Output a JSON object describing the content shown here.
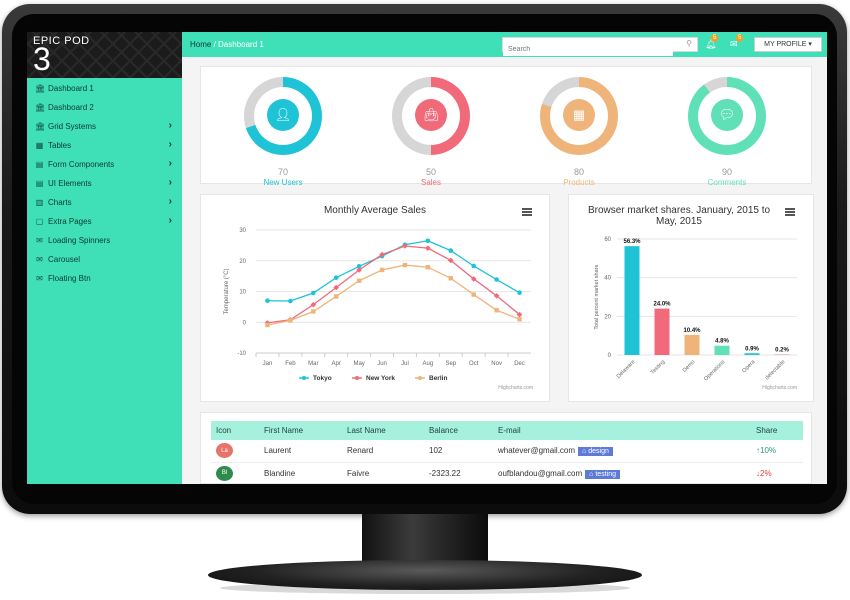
{
  "brand": {
    "name": "EPIC POD",
    "number": "3"
  },
  "sidebar": {
    "items": [
      {
        "label": "Dashboard 1",
        "icon": "bank-icon",
        "has_submenu": false
      },
      {
        "label": "Dashboard 2",
        "icon": "bank-icon",
        "has_submenu": false
      },
      {
        "label": "Grid Systems",
        "icon": "bank-icon",
        "has_submenu": true
      },
      {
        "label": "Tables",
        "icon": "table-icon",
        "has_submenu": true
      },
      {
        "label": "Form Components",
        "icon": "form-icon",
        "has_submenu": true
      },
      {
        "label": "UI Elements",
        "icon": "form-icon",
        "has_submenu": true
      },
      {
        "label": "Charts",
        "icon": "chart-icon",
        "has_submenu": true
      },
      {
        "label": "Extra Pages",
        "icon": "file-icon",
        "has_submenu": true
      },
      {
        "label": "Loading Spinners",
        "icon": "envelope-icon",
        "has_submenu": false
      },
      {
        "label": "Carousel",
        "icon": "envelope-icon",
        "has_submenu": false
      },
      {
        "label": "Floating Btn",
        "icon": "envelope-icon",
        "has_submenu": false
      }
    ]
  },
  "topbar": {
    "breadcrumb_home": "Home",
    "breadcrumb_sep": " / ",
    "breadcrumb_current": "Dashboard 1",
    "search_placeholder": "Search",
    "alerts_count": "5",
    "messages_count": "5",
    "profile_label": "MY PROFILE ▾"
  },
  "stats": [
    {
      "value": "70",
      "label": "New Users",
      "color": "#1ec3d6",
      "percent": 70
    },
    {
      "value": "50",
      "label": "Sales",
      "color": "#f06a7a",
      "percent": 50
    },
    {
      "value": "80",
      "label": "Products",
      "color": "#efb47a",
      "percent": 80
    },
    {
      "value": "90",
      "label": "Comments",
      "color": "#5fe0b6",
      "percent": 90
    }
  ],
  "chart_data": [
    {
      "type": "line",
      "title": "Monthly Average Sales",
      "ylabel": "Temperature (°C)",
      "categories": [
        "Jan",
        "Feb",
        "Mar",
        "Apr",
        "May",
        "Jun",
        "Jul",
        "Aug",
        "Sep",
        "Oct",
        "Nov",
        "Dec"
      ],
      "ylim": [
        -10,
        30
      ],
      "yticks": [
        -10,
        0,
        10,
        20,
        30
      ],
      "series": [
        {
          "name": "Tokyo",
          "color": "#1ec3d6",
          "values": [
            7.0,
            6.9,
            9.5,
            14.5,
            18.2,
            21.5,
            25.2,
            26.5,
            23.3,
            18.3,
            13.9,
            9.6
          ]
        },
        {
          "name": "New York",
          "color": "#f06a7a",
          "values": [
            -0.2,
            0.8,
            5.7,
            11.3,
            17.0,
            22.0,
            24.8,
            24.1,
            20.1,
            14.1,
            8.6,
            2.5
          ]
        },
        {
          "name": "Berlin",
          "color": "#efb47a",
          "values": [
            -0.9,
            0.6,
            3.5,
            8.4,
            13.5,
            17.0,
            18.6,
            17.9,
            14.3,
            9.0,
            3.9,
            1.0
          ]
        }
      ],
      "legend": "bottom",
      "credits": "Highcharts.com"
    },
    {
      "type": "bar",
      "title": "Browser market shares. January, 2015 to May, 2015",
      "ylabel": "Total percent market share",
      "categories": [
        "Delaware",
        "Testing",
        "Demo",
        "Operations",
        "Opera",
        "detectable"
      ],
      "values": [
        56.3,
        24.0,
        10.4,
        4.8,
        0.9,
        0.2
      ],
      "data_labels": [
        "56.3%",
        "24.0%",
        "10.4%",
        "4.8%",
        "0.9%",
        "0.2%"
      ],
      "colors": [
        "#1ec3d6",
        "#f06a7a",
        "#efb47a",
        "#5fe0b6",
        "#1ec3d6",
        "#f06a7a"
      ],
      "ylim": [
        0,
        60
      ],
      "yticks": [
        0,
        20,
        40,
        60
      ],
      "credits": "Highcharts.com"
    }
  ],
  "table": {
    "headers": [
      "Icon",
      "First Name",
      "Last Name",
      "Balance",
      "E-mail",
      "Share"
    ],
    "rows": [
      {
        "initials": "La",
        "avatar_color": "#e8736a",
        "first": "Laurent",
        "last": "Renard",
        "balance": "102",
        "email": "whatever@gmail.com",
        "tag": "design",
        "share": "10%",
        "share_dir": "up"
      },
      {
        "initials": "Bl",
        "avatar_color": "#2f8a4e",
        "first": "Blandine",
        "last": "Faivre",
        "balance": "-2323.22",
        "email": "oufblandou@gmail.com",
        "tag": "testing",
        "share": "2%",
        "share_dir": "down"
      }
    ]
  }
}
